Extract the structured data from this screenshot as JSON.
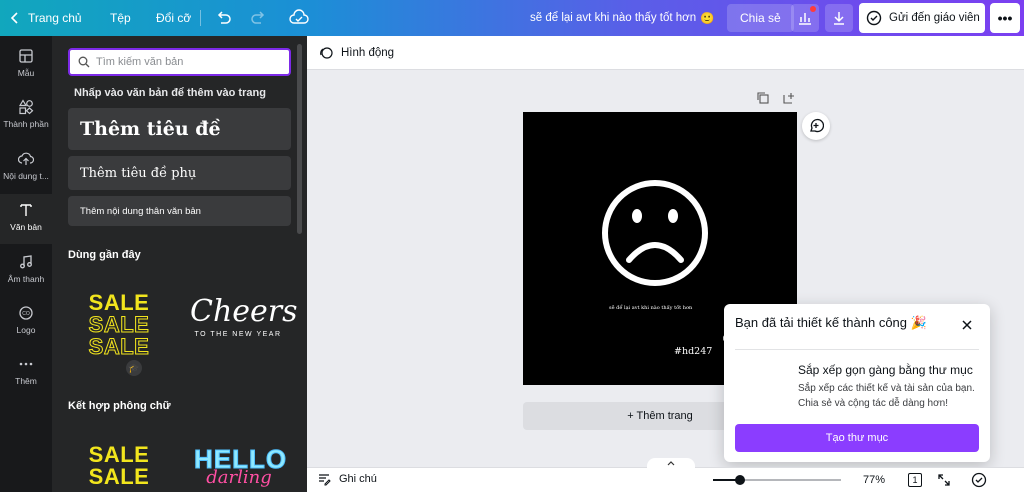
{
  "topbar": {
    "home_label": "Trang chủ",
    "file_label": "Tệp",
    "resize_label": "Đổi cỡ",
    "document_title": "sẽ để lại avt khi nào thấy tốt hơn",
    "title_emoji": "🙂",
    "share_label": "Chia sẻ",
    "send_label": "Gửi đến giáo viên",
    "more_label": "•••",
    "gradient_start": "#11a7bd",
    "gradient_end": "#7b3ff1"
  },
  "rail": {
    "items": [
      {
        "label": "Mẫu",
        "icon": "template-icon"
      },
      {
        "label": "Thành phần",
        "icon": "elements-icon"
      },
      {
        "label": "Nội dung t...",
        "icon": "upload-icon"
      },
      {
        "label": "Văn bản",
        "icon": "text-icon"
      },
      {
        "label": "Âm thanh",
        "icon": "music-icon"
      },
      {
        "label": "Logo",
        "icon": "logo-icon"
      },
      {
        "label": "Thêm",
        "icon": "more-dots-icon"
      }
    ],
    "active_index": 3
  },
  "panel": {
    "search_placeholder": "Tìm kiếm văn bản",
    "hint": "Nhấp vào văn bản để thêm vào trang",
    "add_heading": "Thêm tiêu đề",
    "add_subheading": "Thêm tiêu đề phụ",
    "add_body": "Thêm nội dung thân văn bản",
    "recent_title": "Dùng gần đây",
    "combos_title": "Kết hợp phông chữ",
    "sale_word": "SALE",
    "cheers_main": "Cheers",
    "cheers_sub": "TO THE NEW YEAR",
    "hello_main": "HELLO",
    "hello_sub": "darling"
  },
  "canvas": {
    "animate_label": "Hình động",
    "design_caption": "sẽ để lại avt khi nào thấy tốt hơn",
    "handle_line1": "@linhchibui19",
    "handle_line2": "#hd247",
    "add_page_label": "+ Thêm trang"
  },
  "popup": {
    "title": "Bạn đã tải thiết kế thành công",
    "title_emoji": "🎉",
    "heading": "Sắp xếp gọn gàng bằng thư mục",
    "description": "Sắp xếp các thiết kế và tài sản của bạn. Chia sẻ và cộng tác dễ dàng hơn!",
    "button_label": "Tạo thư mục",
    "button_color": "#8b3dff"
  },
  "bottombar": {
    "notes_label": "Ghi chú",
    "zoom_label": "77%",
    "zoom_value": 0.77,
    "page_number": "1"
  }
}
